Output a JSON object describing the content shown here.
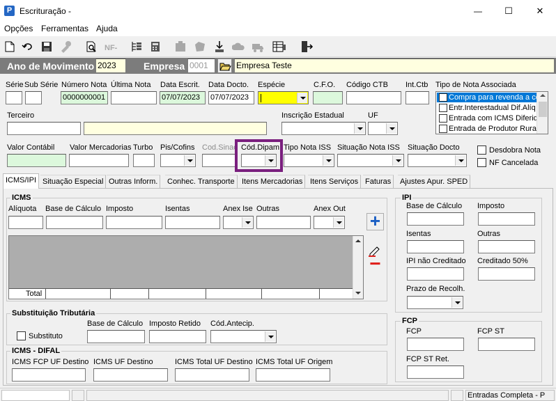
{
  "window": {
    "title": "Escrituração -",
    "minimize_label": "—",
    "maximize_label": "☐",
    "close_label": "✕"
  },
  "menu": [
    "Opções",
    "Ferramentas",
    "Ajuda"
  ],
  "header": {
    "ano_label": "Ano de Movimento",
    "ano_value": "2023",
    "empresa_label": "Empresa",
    "empresa_code": "0001",
    "empresa_name": "Empresa Teste"
  },
  "row1": {
    "serie_label": "Série",
    "subserie_label": "Sub Série",
    "numero_label": "Número Nota",
    "numero_value": "0000000001",
    "ultima_label": "Última Nota",
    "data_escrit_label": "Data Escrit.",
    "data_escrit_value": "07/07/2023",
    "data_docto_label": "Data Docto.",
    "data_docto_value": "07/07/2023",
    "especie_label": "Espécie",
    "cfo_label": "C.F.O.",
    "codigo_ctb_label": "Código CTB",
    "int_ctb_label": "Int.Ctb",
    "tipo_nota_label": "Tipo de Nota Associada",
    "tipo_nota_items": [
      "Compra para revenda a co",
      "Entr.Interestadual Dif.Alíq",
      "Entrada com ICMS Diferido",
      "Entrada de Produtor Rural"
    ]
  },
  "row2": {
    "terceiro_label": "Terceiro",
    "inscricao_label": "Inscrição Estadual",
    "uf_label": "UF"
  },
  "row3": {
    "valor_contabil_label": "Valor Contábil",
    "valor_merc_label": "Valor Mercadorias",
    "turbo_label": "Turbo",
    "pis_label": "Pis/Cofins",
    "cod_sinac_label": "Cod.Sinac",
    "cod_dipam_label": "Cód.Dipam",
    "tipo_iss_label": "Tipo Nota ISS",
    "situacao_iss_label": "Situação Nota ISS",
    "situacao_docto_label": "Situação Docto",
    "desdobra_label": "Desdobra Nota",
    "nf_cancelada_label": "NF Cancelada"
  },
  "tabs": [
    "ICMS/IPI",
    "Situação Especial",
    "Outras Inform.",
    "Conhec. Transporte",
    "Itens Mercadorias",
    "Itens Serviços",
    "Faturas",
    "Ajustes Apur. SPED"
  ],
  "icms": {
    "title": "ICMS",
    "aliquota_label": "Alíquota",
    "base_label": "Base de Cálculo",
    "imposto_label": "Imposto",
    "isentas_label": "Isentas",
    "anex_ise_label": "Anex Ise",
    "outras_label": "Outras",
    "anex_out_label": "Anex Out",
    "grid_total_label": "Total",
    "add_label": "+",
    "remove_label": "−"
  },
  "st": {
    "title": "Substituição Tributária",
    "substituto_label": "Substituto",
    "base_label": "Base de Cálculo",
    "imposto_retido_label": "Imposto Retido",
    "cod_antecip_label": "Cód.Antecip."
  },
  "difal": {
    "title": "ICMS - DIFAL",
    "fcp_uf_label": "ICMS FCP UF Destino",
    "uf_destino_label": "ICMS UF Destino",
    "total_destino_label": "ICMS Total UF Destino",
    "total_origem_label": "ICMS Total UF Origem"
  },
  "ipi": {
    "title": "IPI",
    "base_label": "Base de Cálculo",
    "imposto_label": "Imposto",
    "isentas_label": "Isentas",
    "outras_label": "Outras",
    "nao_creditado_label": "IPI não Creditado",
    "creditado_label": "Creditado 50%",
    "prazo_label": "Prazo de Recolh."
  },
  "fcp": {
    "title": "FCP",
    "fcp_label": "FCP",
    "fcp_st_label": "FCP ST",
    "fcp_st_ret_label": "FCP ST Ret."
  },
  "statusbar": {
    "right_text": "Entradas Completa - P"
  },
  "colors": {
    "header_bar": "#7c7c7c",
    "highlight_green": "#dcf8dc",
    "highlight_yellow": "#ffff00",
    "light_yellow": "#ffffe0",
    "dipam_box": "#7a1f7e",
    "list_selection": "#0078d7",
    "add_icon": "#1a5fc4",
    "remove_icon": "#e0201b"
  }
}
